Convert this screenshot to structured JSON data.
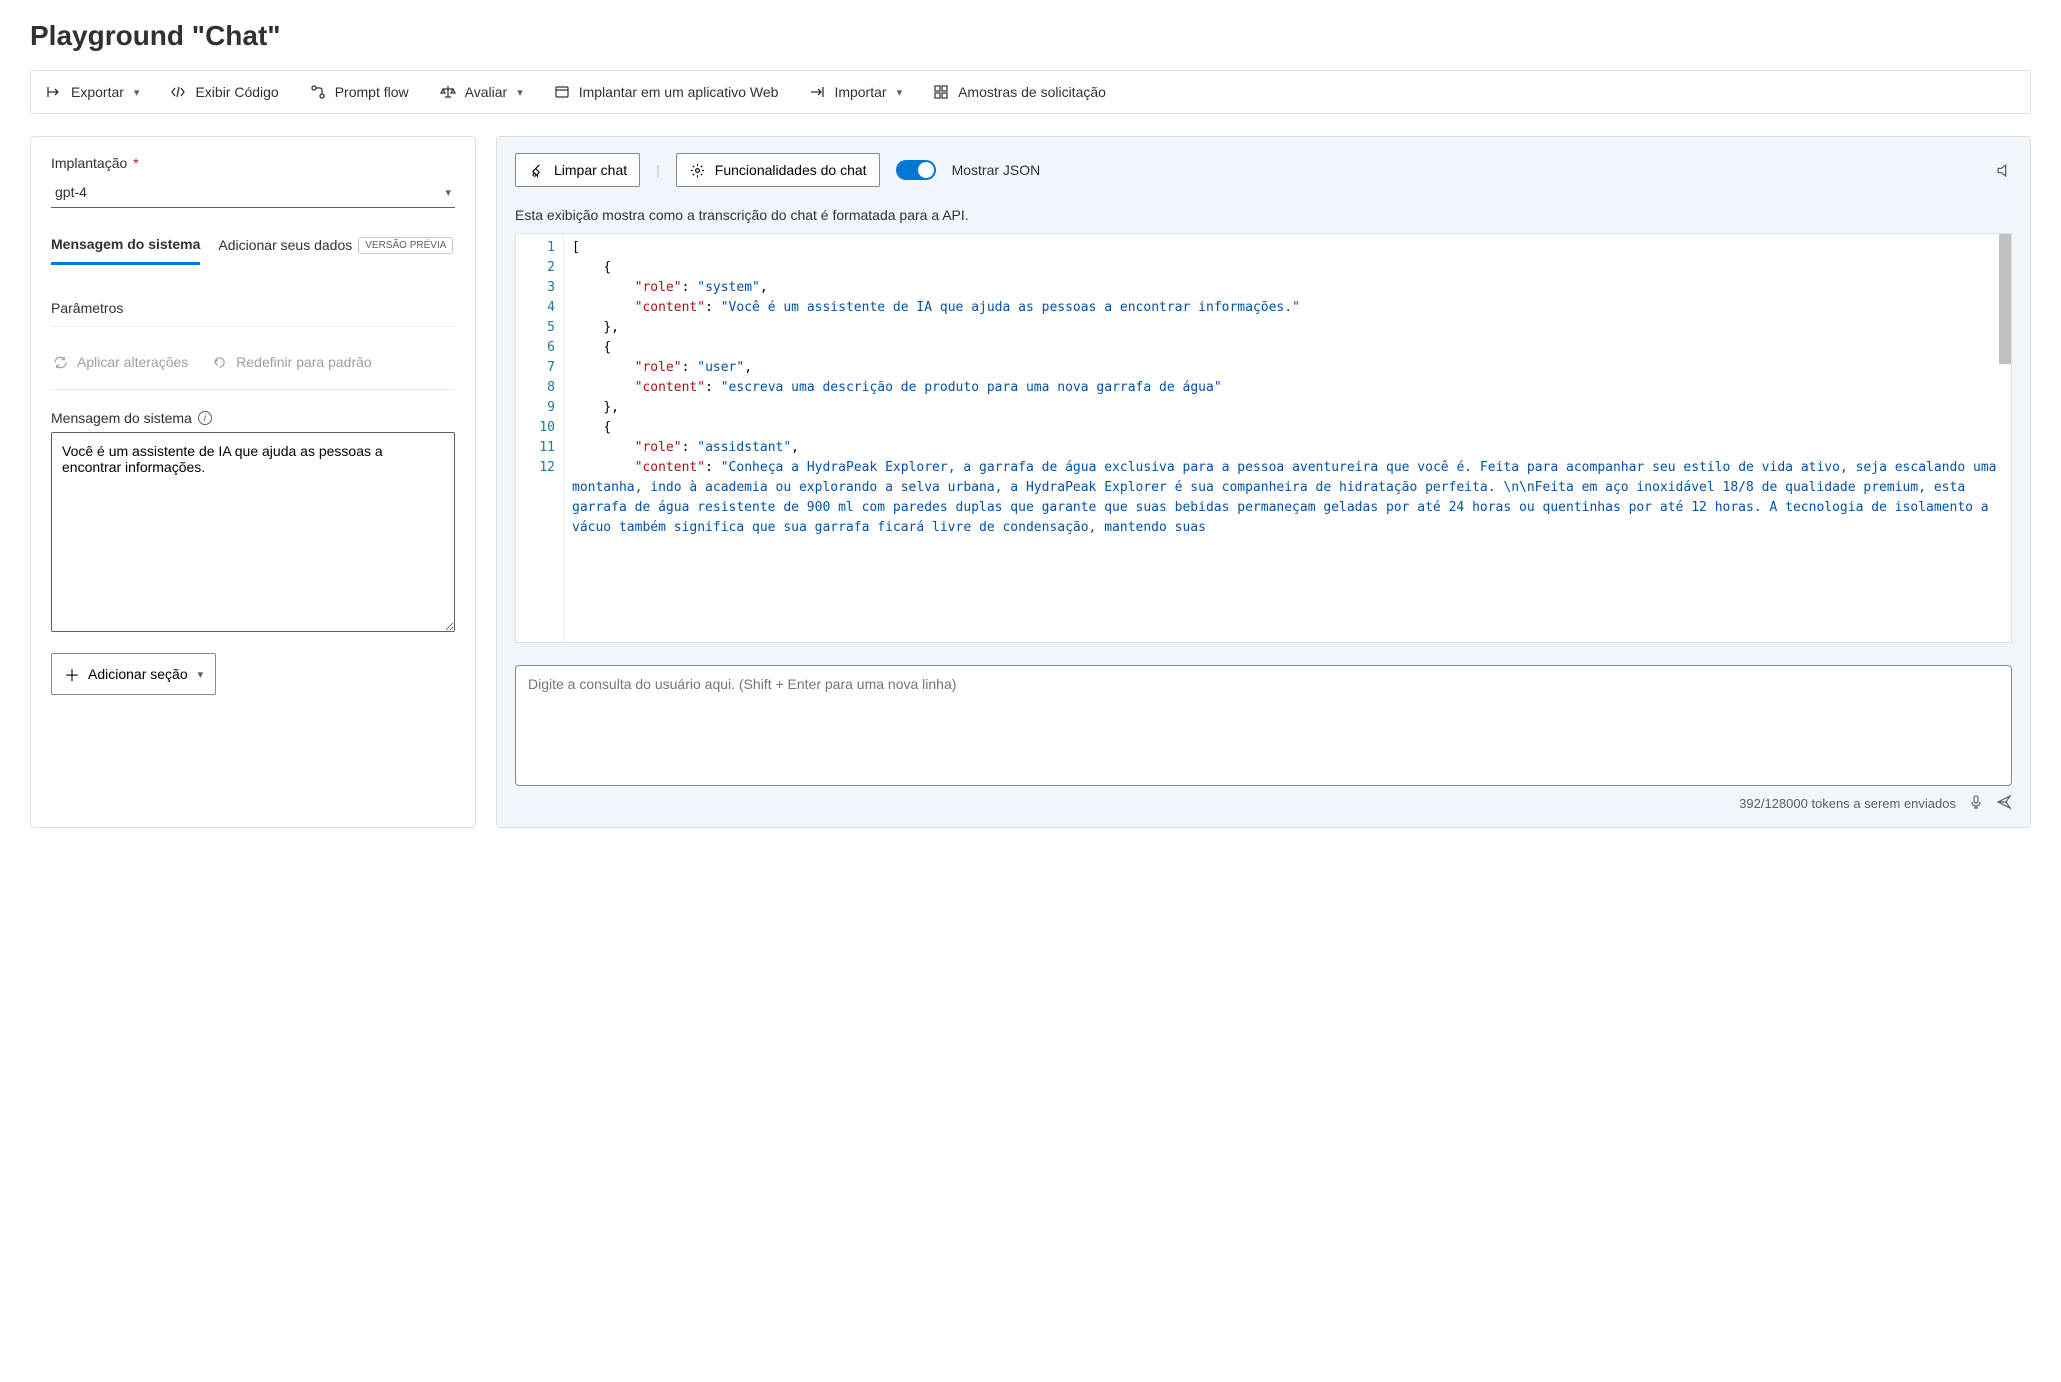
{
  "title": "Playground \"Chat\"",
  "toolbar": {
    "export": "Exportar",
    "view_code": "Exibir Código",
    "prompt_flow": "Prompt flow",
    "evaluate": "Avaliar",
    "deploy": "Implantar em um aplicativo Web",
    "import": "Importar",
    "samples": "Amostras de solicitação"
  },
  "left": {
    "deployment_label": "Implantação",
    "deployment_value": "gpt-4",
    "tabs": {
      "system_msg": "Mensagem do sistema",
      "add_data": "Adicionar seus dados",
      "preview_badge": "VERSÃO PRÉVIA",
      "params": "Parâmetros"
    },
    "apply": "Aplicar alterações",
    "reset": "Redefinir para padrão",
    "sysmsg_label": "Mensagem do sistema",
    "sysmsg_value": "Você é um assistente de IA que ajuda as pessoas a encontrar informações.",
    "add_section": "Adicionar seção"
  },
  "chat": {
    "clear": "Limpar chat",
    "features": "Funcionalidades do chat",
    "show_json": "Mostrar JSON",
    "desc": "Esta exibição mostra como a transcrição do chat é formatada para a API.",
    "input_placeholder": "Digite a consulta do usuário aqui. (Shift + Enter para uma nova linha)",
    "tokens": "392/128000 tokens a serem enviados"
  },
  "code_lines": [
    "1",
    "2",
    "3",
    "4",
    "5",
    "6",
    "7",
    "8",
    "9",
    "10",
    "11",
    "12"
  ],
  "json_payload": [
    {
      "role": "system",
      "content": "Você é um assistente de IA que ajuda as pessoas a encontrar informações."
    },
    {
      "role": "user",
      "content": "escreva uma descrição de produto para uma nova garrafa de água"
    },
    {
      "role": "assidstant",
      "content": "Conheça a HydraPeak Explorer, a garrafa de água exclusiva para a pessoa aventureira que você é. Feita para acompanhar seu estilo de vida ativo, seja escalando uma montanha, indo à academia ou explorando a selva urbana, a HydraPeak Explorer é sua companheira de hidratação perfeita. \\n\\nFeita em aço inoxidável 18/8 de qualidade premium, esta garrafa de água resistente de 900 ml com paredes duplas que garante que suas bebidas permaneçam geladas por até 24 horas ou quentinhas por até 12 horas. A tecnologia de isolamento a vácuo também significa que sua garrafa ficará livre de condensação, mantendo suas"
    }
  ]
}
